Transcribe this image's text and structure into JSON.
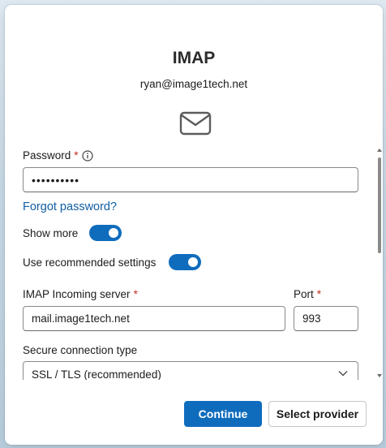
{
  "dialog": {
    "title": "IMAP",
    "email": "ryan@image1tech.net"
  },
  "form": {
    "password": {
      "label": "Password",
      "required_mark": "*",
      "value": "••••••••••"
    },
    "forgot_password": "Forgot password?",
    "show_more": {
      "label": "Show more",
      "on": true
    },
    "use_recommended": {
      "label": "Use recommended settings",
      "on": true
    },
    "incoming_server": {
      "label": "IMAP Incoming server",
      "required_mark": "*",
      "value": "mail.image1tech.net"
    },
    "port": {
      "label": "Port",
      "required_mark": "*",
      "value": "993"
    },
    "secure_connection": {
      "label": "Secure connection type",
      "selected": "SSL / TLS (recommended)"
    }
  },
  "footer": {
    "continue_label": "Continue",
    "select_provider_label": "Select provider"
  },
  "colors": {
    "accent": "#0f6cbd",
    "link": "#115ea3",
    "required": "#c42b1c"
  },
  "icons": [
    "mail-icon",
    "info-icon",
    "chevron-down-icon"
  ]
}
